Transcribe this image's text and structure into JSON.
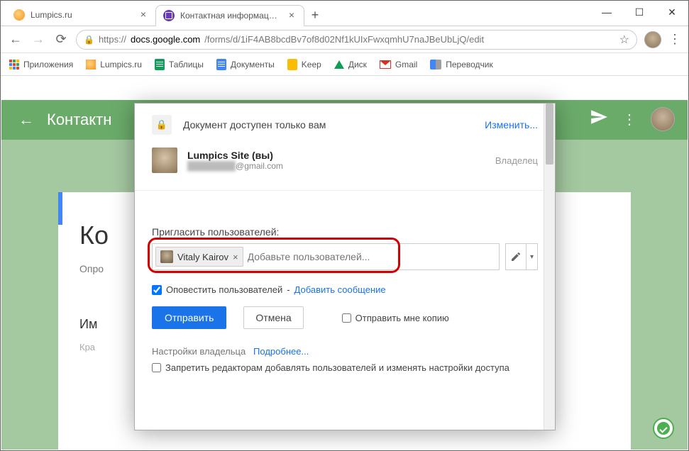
{
  "window": {
    "min": "—",
    "max": "☐",
    "close": "✕"
  },
  "tabs": [
    {
      "title": "Lumpics.ru"
    },
    {
      "title": "Контактная информация - Goo…"
    }
  ],
  "addressbar": {
    "scheme": "https://",
    "host": "docs.google.com",
    "path": "/forms/d/1iF4AB8bcdBv7of8d02Nf1kUIxFwxqmhU7naJBeUbLjQ/edit"
  },
  "bookmarks": {
    "apps": "Приложения",
    "items": [
      "Lumpics.ru",
      "Таблицы",
      "Документы",
      "Keep",
      "Диск",
      "Gmail",
      "Переводчик"
    ]
  },
  "forms": {
    "title": "Контактн",
    "q_title": "Ко",
    "q_sub": "Опро",
    "field_label": "Им",
    "field_hint": "Кра"
  },
  "dialog": {
    "private_text": "Документ доступен только вам",
    "change_link": "Изменить...",
    "owner": {
      "name": "Lumpics Site (вы)",
      "email_suffix": "@gmail.com",
      "role": "Владелец"
    },
    "invite_label": "Пригласить пользователей:",
    "chip_name": "Vitaly Kairov",
    "add_placeholder": "Добавьте пользователей...",
    "notify_label": "Оповестить пользователей",
    "notify_dash": " - ",
    "add_message": "Добавить сообщение",
    "send_btn": "Отправить",
    "cancel_btn": "Отмена",
    "send_copy": "Отправить мне копию",
    "owner_settings": "Настройки владельца",
    "learn_more": "Подробнее...",
    "restrict": "Запретить редакторам добавлять пользователей и изменять настройки доступа"
  }
}
